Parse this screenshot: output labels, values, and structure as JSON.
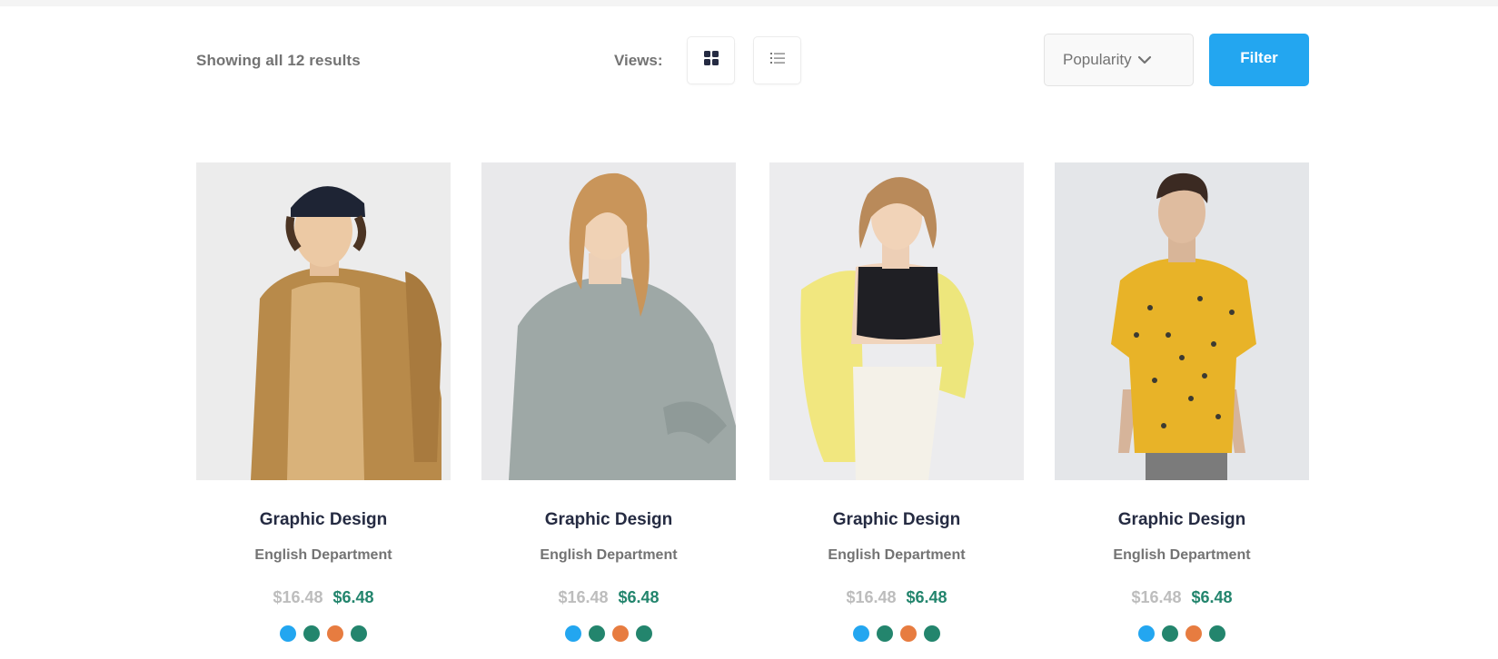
{
  "toolbar": {
    "results_text": "Showing all 12 results",
    "views_label": "Views:",
    "sort_label": "Popularity",
    "filter_label": "Filter",
    "grid_view_icon": "grid-icon",
    "list_view_icon": "list-icon"
  },
  "colors": {
    "accent": "#23a6f0",
    "price_new": "#23856d",
    "price_old": "#bdbdbd",
    "heading": "#252b42",
    "muted": "#737373",
    "swatches": [
      "#23a6f0",
      "#23856d",
      "#e77c40",
      "#23856d"
    ]
  },
  "products": [
    {
      "title": "Graphic Design",
      "department": "English Department",
      "old_price": "$16.48",
      "new_price": "$6.48",
      "image": "man-tan-jacket-cap"
    },
    {
      "title": "Graphic Design",
      "department": "English Department",
      "old_price": "$16.48",
      "new_price": "$6.48",
      "image": "woman-grey-sweater"
    },
    {
      "title": "Graphic Design",
      "department": "English Department",
      "old_price": "$16.48",
      "new_price": "$6.48",
      "image": "woman-yellow-cardigan"
    },
    {
      "title": "Graphic Design",
      "department": "English Department",
      "old_price": "$16.48",
      "new_price": "$6.48",
      "image": "man-yellow-shirt"
    }
  ]
}
